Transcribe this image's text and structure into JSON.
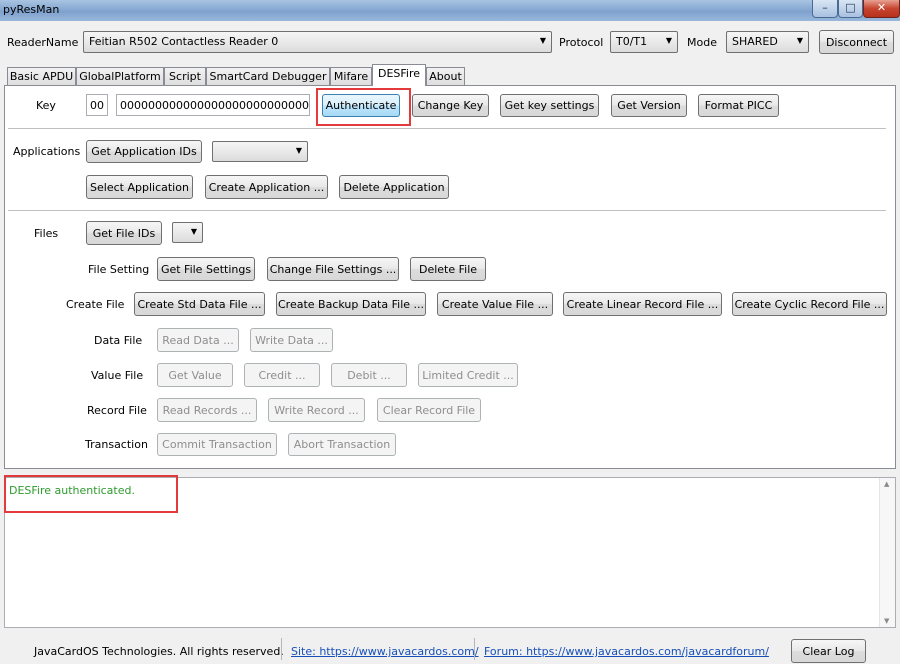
{
  "window": {
    "title": "pyResMan",
    "minimize": "–",
    "maximize": "□",
    "close": "✕"
  },
  "reader": {
    "label": "ReaderName",
    "value": "Feitian R502 Contactless Reader 0",
    "protocol_label": "Protocol",
    "protocol_value": "T0/T1",
    "mode_label": "Mode",
    "mode_value": "SHARED",
    "disconnect": "Disconnect"
  },
  "tabs": [
    "Basic APDU",
    "GlobalPlatform",
    "Script",
    "SmartCard Debugger",
    "Mifare",
    "DESFire",
    "About"
  ],
  "active_tab": "DESFire",
  "key": {
    "label": "Key",
    "number": "00",
    "value": "00000000000000000000000000000000",
    "authenticate": "Authenticate",
    "change_key": "Change Key",
    "get_key_settings": "Get key settings",
    "get_version": "Get Version",
    "format_picc": "Format PICC"
  },
  "applications": {
    "label": "Applications",
    "get_ids": "Get Application IDs",
    "select": "Select Application",
    "create": "Create Application ...",
    "delete": "Delete Application"
  },
  "files": {
    "label": "Files",
    "get_ids": "Get File IDs",
    "setting_label": "File Setting",
    "get_settings": "Get File Settings",
    "change_settings": "Change File Settings ...",
    "delete": "Delete File",
    "create_label": "Create File",
    "create_std": "Create Std Data File ...",
    "create_backup": "Create Backup Data File ...",
    "create_value": "Create Value File ...",
    "create_linear": "Create Linear Record File ...",
    "create_cyclic": "Create Cyclic Record File ...",
    "data_label": "Data File",
    "read_data": "Read Data ...",
    "write_data": "Write Data ...",
    "value_label": "Value File",
    "get_value": "Get Value",
    "credit": "Credit ...",
    "debit": "Debit ...",
    "limited_credit": "Limited Credit ...",
    "record_label": "Record File",
    "read_records": "Read Records ...",
    "write_record": "Write Record ...",
    "clear_record": "Clear Record File",
    "transaction_label": "Transaction",
    "commit": "Commit Transaction",
    "abort": "Abort Transaction"
  },
  "log": {
    "message": "DESFire authenticated.",
    "text_color": "#2e9a2e"
  },
  "footer": {
    "copyright": "JavaCardOS Technologies. All rights reserved.",
    "site": "Site: https://www.javacardos.com/",
    "forum": "Forum: https://www.javacardos.com/javacardforum/",
    "clear_log": "Clear Log"
  },
  "highlight_color": "#e33b3b"
}
